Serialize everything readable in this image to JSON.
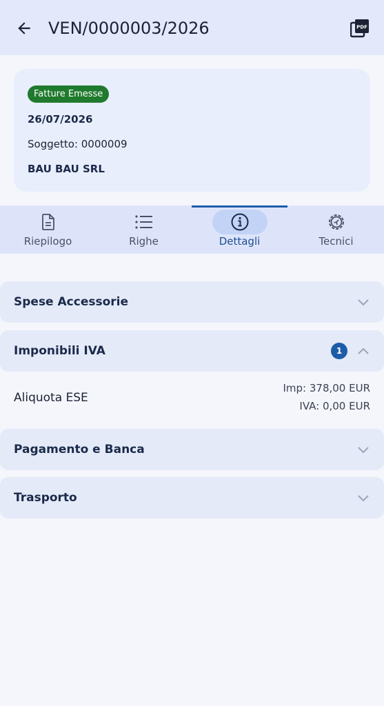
{
  "header": {
    "title": "VEN/0000003/2026",
    "back_icon": "arrow-left-icon",
    "pdf_icon": "pdf-icon",
    "pdf_icon_text": "PDF"
  },
  "card": {
    "badge": "Fatture Emesse",
    "date": "26/07/2026",
    "subject": "Soggetto: 0000009",
    "company": "BAU BAU SRL"
  },
  "tabs": [
    {
      "label": "Riepilogo",
      "icon": "document-icon",
      "active": false
    },
    {
      "label": "Righe",
      "icon": "list-icon",
      "active": false
    },
    {
      "label": "Dettagli",
      "icon": "info-icon",
      "active": true
    },
    {
      "label": "Tecnici",
      "icon": "gear-icon",
      "active": false
    }
  ],
  "sections": {
    "spese": {
      "title": "Spese Accessorie",
      "expanded": false
    },
    "imponibili": {
      "title": "Imponibili IVA",
      "expanded": true,
      "count": "1"
    },
    "pagamento": {
      "title": "Pagamento e Banca",
      "expanded": false
    },
    "trasporto": {
      "title": "Trasporto",
      "expanded": false
    }
  },
  "vat_rows": [
    {
      "label": "Aliquota ESE",
      "imp": "Imp: 378,00 EUR",
      "iva": "IVA: 0,00 EUR"
    }
  ],
  "colors": {
    "appbar_bg": "#e3e8fb",
    "badge_green": "#1f7a2e",
    "accent_blue": "#1d5ca8",
    "active_pill": "#c2d3f6"
  }
}
